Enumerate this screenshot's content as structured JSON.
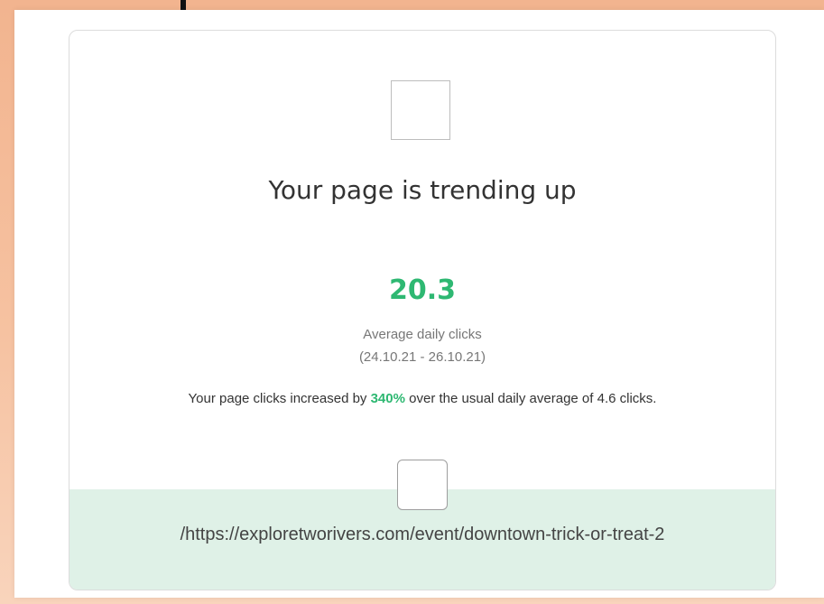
{
  "card": {
    "title": "Your page is trending up",
    "metric_value": "20.3",
    "metric_label": "Average daily clicks",
    "date_range": "(24.10.21 - 26.10.21)",
    "description": {
      "before": "Your page clicks increased by ",
      "percent": "340%",
      "after": " over the usual daily average of 4.6 clicks."
    },
    "page_url": "/https://exploretworivers.com/event/downtown-trick-or-treat-2"
  },
  "colors": {
    "accent_green": "#2eb872",
    "footer_bg": "#dff1e7",
    "page_bg": "#f2b48f"
  },
  "icons": {
    "card_icon": "trend-image-icon",
    "footer_icon": "page-thumbnail-icon"
  }
}
